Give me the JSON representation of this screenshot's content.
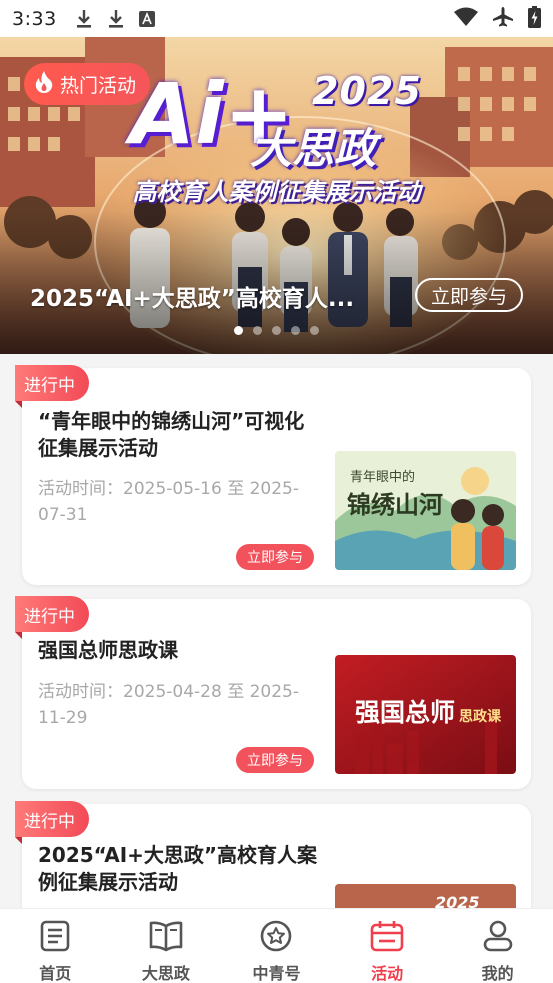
{
  "status_bar": {
    "time": "3:33",
    "left_icons": [
      "download-icon",
      "download-icon",
      "font-icon"
    ],
    "right_icons": [
      "wifi-icon",
      "airplane-icon",
      "battery-charging-icon"
    ]
  },
  "banner": {
    "badge_label": "热门活动",
    "badge_icon": "flame-icon",
    "poster_ai": "Ai+",
    "poster_year": "2025",
    "poster_title": "大思政",
    "poster_subtitle": "高校育人案例征集展示活动",
    "caption": "2025“AI+大思政”高校育人...",
    "join_label": "立即参与",
    "dot_count": 5,
    "active_dot": 0
  },
  "activities": [
    {
      "status": "进行中",
      "title": "“青年眼中的锦绣山河”可视化征集展示活动",
      "time": "活动时间：2025-05-16 至 2025-07-31",
      "join_label": "立即参与",
      "image_text": "锦绣山河",
      "image_subtext": "青年眼中的"
    },
    {
      "status": "进行中",
      "title": "强国总师思政课",
      "time": "活动时间：2025-04-28 至 2025-11-29",
      "join_label": "立即参与",
      "image_text": "强国总师",
      "image_subtext": "思政课"
    },
    {
      "status": "进行中",
      "title": "2025“AI+大思政”高校育人案例征集展示活动",
      "image_text": "2025"
    }
  ],
  "tabs": [
    {
      "label": "首页",
      "icon": "home-document-icon",
      "active": false
    },
    {
      "label": "大思政",
      "icon": "open-book-icon",
      "active": false
    },
    {
      "label": "中青号",
      "icon": "star-circle-icon",
      "active": false
    },
    {
      "label": "活动",
      "icon": "calendar-icon",
      "active": true
    },
    {
      "label": "我的",
      "icon": "user-icon",
      "active": false
    }
  ],
  "colors": {
    "accent": "#f0404e",
    "status_tag": "#f24a57",
    "join_button": "#f2525c"
  }
}
